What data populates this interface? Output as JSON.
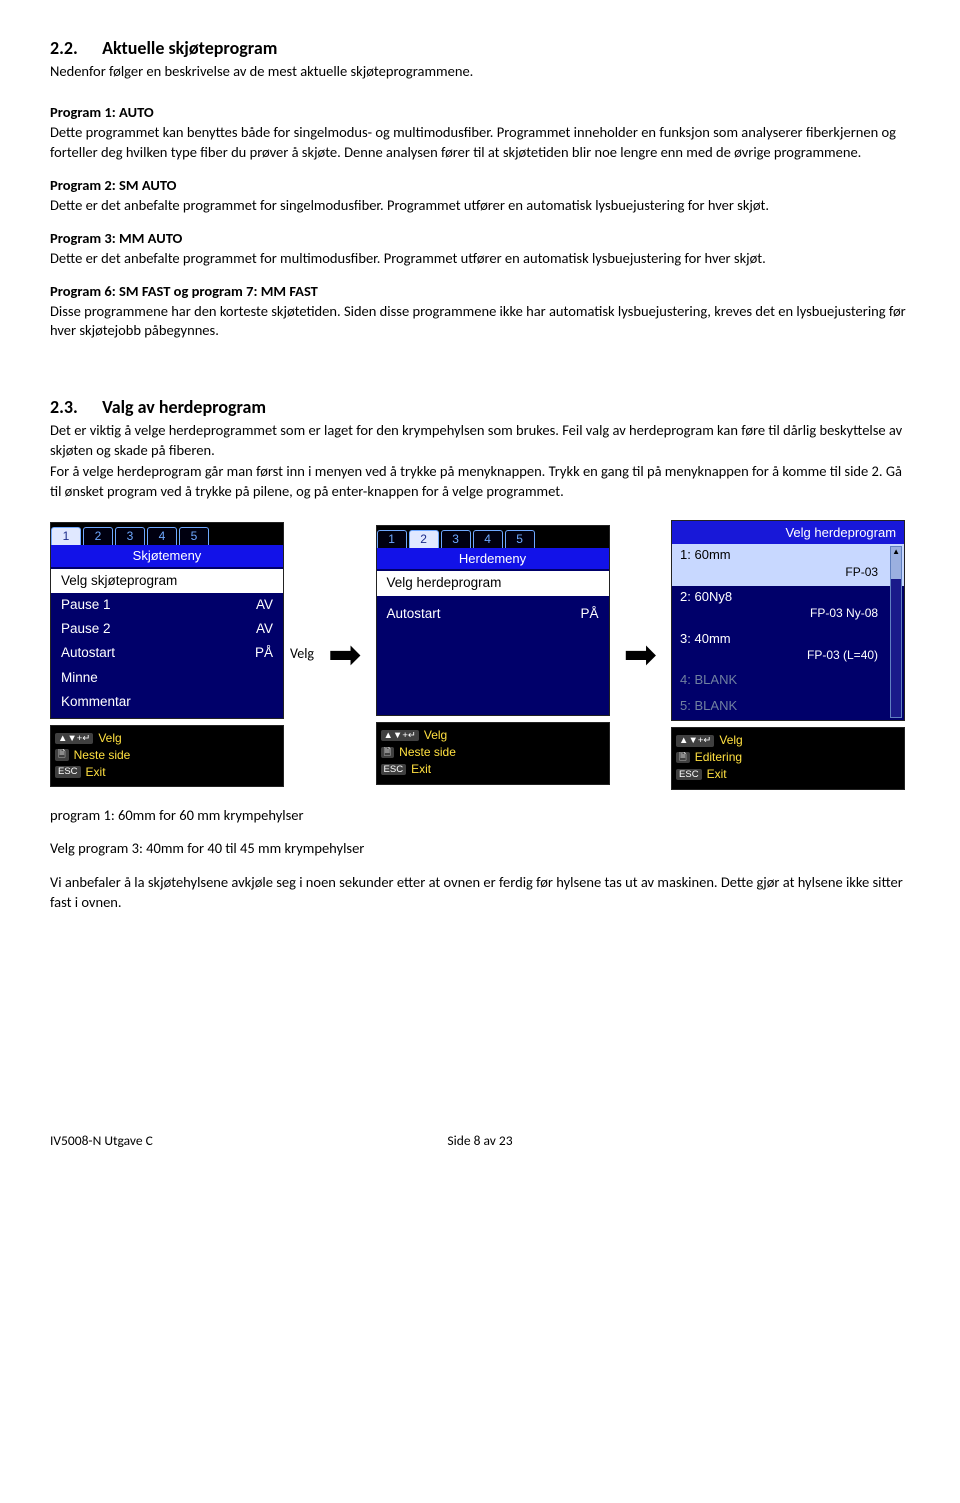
{
  "section22": {
    "num": "2.2.",
    "title": "Aktuelle skjøteprogram",
    "intro": "Nedenfor følger en beskrivelse av de mest aktuelle skjøteprogrammene.",
    "p1_h": "Program 1: AUTO",
    "p1_t": "Dette programmet kan benyttes både for singelmodus- og multimodusfiber. Programmet inneholder en funksjon som analyserer fiberkjernen og forteller deg hvilken type fiber du prøver å skjøte. Denne analysen fører til at skjøtetiden blir noe lengre enn med de øvrige programmene.",
    "p2_h": "Program 2: SM AUTO",
    "p2_t": "Dette er det anbefalte programmet for singelmodusfiber. Programmet utfører en automatisk lysbuejustering for hver skjøt.",
    "p3_h": "Program 3: MM AUTO",
    "p3_t": "Dette er det anbefalte programmet for multimodusfiber. Programmet utfører en automatisk lysbuejustering for hver skjøt.",
    "p6_h": "Program 6: SM FAST og program 7: MM FAST",
    "p6_t": "Disse programmene har den korteste skjøtetiden. Siden disse programmene ikke har automatisk lysbuejustering, kreves det en lysbuejustering før hver skjøtejobb påbegynnes."
  },
  "section23": {
    "num": "2.3.",
    "title": "Valg av herdeprogram",
    "para1": "Det er viktig å velge herdeprogrammet som er laget for den krympehylsen som brukes. Feil valg av herdeprogram kan føre til dårlig beskyttelse av skjøten og skade på fiberen.",
    "para2": "For å velge herdeprogram går man først inn i menyen ved å trykke på menyknappen.  Trykk en gang til på menyknappen for å komme til side 2.  Gå til ønsket program ved å trykke på pilene, og på enter-knappen for å velge programmet."
  },
  "screen1": {
    "tabs": [
      "1",
      "2",
      "3",
      "4",
      "5"
    ],
    "activeTab": 0,
    "title": "Skjøtemeny",
    "items": [
      {
        "l": "Velg skjøteprogram",
        "r": "",
        "sel": true
      },
      {
        "l": "Pause 1",
        "r": "AV"
      },
      {
        "l": "Pause 2",
        "r": "AV"
      },
      {
        "l": "Autostart",
        "r": "PÅ"
      },
      {
        "l": "Minne",
        "r": ""
      },
      {
        "l": "Kommentar",
        "r": ""
      }
    ]
  },
  "screen2": {
    "tabs": [
      "1",
      "2",
      "3",
      "4",
      "5"
    ],
    "activeTab": 1,
    "title": "Herdemeny",
    "items": [
      {
        "l": "Velg herdeprogram",
        "r": "",
        "sel": true
      },
      {
        "l": "",
        "r": ""
      },
      {
        "l": "Autostart",
        "r": "PÅ"
      }
    ]
  },
  "screen3": {
    "header": "Velg herdeprogram",
    "items": [
      {
        "n": "1:",
        "name": "60mm",
        "sub": "FP-03",
        "sel": true
      },
      {
        "n": "2:",
        "name": "60Ny8",
        "sub": "FP-03 Ny-08"
      },
      {
        "n": "3:",
        "name": "40mm",
        "sub": "FP-03 (L=40)"
      },
      {
        "n": "4:",
        "name": "BLANK",
        "sub": "",
        "dim": true
      },
      {
        "n": "5:",
        "name": "BLANK",
        "sub": "",
        "dim": true
      }
    ]
  },
  "hints1": {
    "a": "Velg",
    "b": "Neste side",
    "c": "Exit"
  },
  "hints3": {
    "a": "Velg",
    "b": "Editering",
    "c": "Exit"
  },
  "keys": {
    "arrows": "▲▼+↵",
    "page": "🗎",
    "esc": "ESC"
  },
  "velg_floating": "Velg",
  "post_screens": {
    "l1": "program 1: 60mm for 60 mm krympehylser",
    "l2": "Velg program 3: 40mm for 40 til 45 mm krympehylser",
    "l3": "Vi anbefaler å la skjøtehylsene avkjøle seg i noen sekunder etter at ovnen er ferdig før hylsene tas ut av maskinen. Dette gjør at hylsene ikke sitter fast i ovnen."
  },
  "footer": {
    "left": "IV5008-N Utgave C",
    "center": "Side 8 av 23"
  }
}
